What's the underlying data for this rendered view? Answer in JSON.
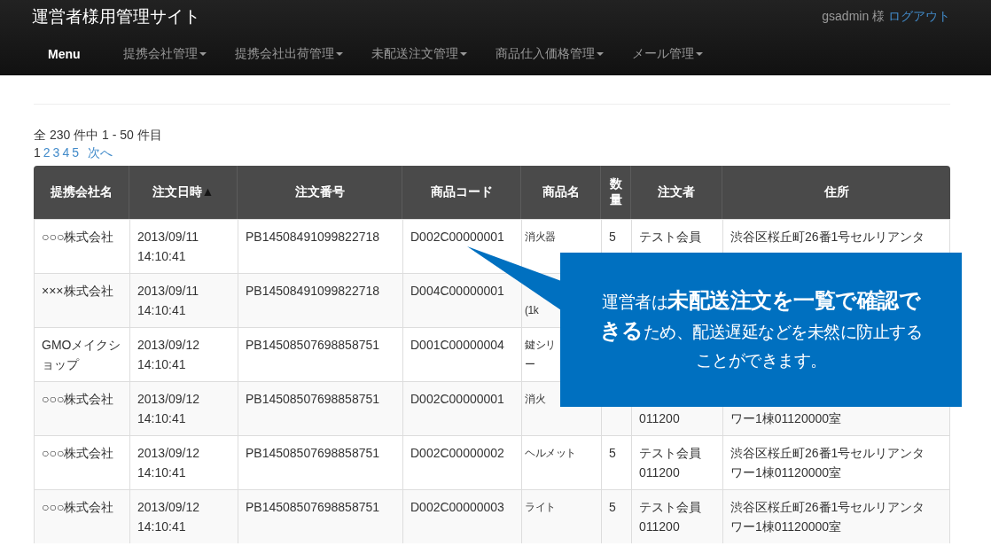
{
  "site_title": "運営者様用管理サイト",
  "user": {
    "name": "gsadmin 様",
    "logout": "ログアウト"
  },
  "nav": [
    {
      "label": "Menu",
      "kind": "brand"
    },
    {
      "label": "提携会社管理",
      "kind": "dropdown"
    },
    {
      "label": "提携会社出荷管理",
      "kind": "dropdown"
    },
    {
      "label": "未配送注文管理",
      "kind": "dropdown"
    },
    {
      "label": "商品仕入価格管理",
      "kind": "dropdown"
    },
    {
      "label": "メール管理",
      "kind": "dropdown"
    }
  ],
  "summary": "全 230 件中 1 - 50 件目",
  "pagination": {
    "pages": [
      {
        "label": "1",
        "selected": true
      },
      {
        "label": "2",
        "selected": false
      },
      {
        "label": "3",
        "selected": false
      },
      {
        "label": "4",
        "selected": false
      },
      {
        "label": "5",
        "selected": false
      }
    ],
    "next": "次へ"
  },
  "table": {
    "columns": [
      {
        "label": "提携会社名"
      },
      {
        "label": "注文日時",
        "sort_mark": "▲"
      },
      {
        "label": "注文番号"
      },
      {
        "label": "商品コード"
      },
      {
        "label": "商品名"
      },
      {
        "label": "数量"
      },
      {
        "label": "注文者"
      },
      {
        "label": "住所"
      }
    ],
    "rows": [
      [
        [
          "○○○株式会社"
        ],
        [
          "2013/09/11",
          "14:10:41"
        ],
        [
          "PB14508491099822718"
        ],
        [
          "D002C00000001"
        ],
        [
          "消火器"
        ],
        [
          "5"
        ],
        [
          "テスト会員",
          null
        ],
        [
          "渋谷区桜丘町26番1号セルリアンタ",
          null
        ]
      ],
      [
        [
          "×××株式会社"
        ],
        [
          "2013/09/11",
          "14:10:41"
        ],
        [
          "PB14508491099822718"
        ],
        [
          "D004C00000001"
        ],
        [
          null,
          "(1k"
        ],
        [],
        [],
        []
      ],
      [
        [
          "GMOメイクシ",
          "ョップ"
        ],
        [
          "2013/09/12",
          "14:10:41"
        ],
        [
          "PB14508507698858751"
        ],
        [
          "D001C00000004"
        ],
        [
          "鍵シリ",
          "ー"
        ],
        [],
        [],
        []
      ],
      [
        [
          "○○○株式会社"
        ],
        [
          "2013/09/12",
          "14:10:41"
        ],
        [
          "PB14508507698858751"
        ],
        [
          "D002C00000001"
        ],
        [
          "消火"
        ],
        [],
        [
          null,
          "011200"
        ],
        [
          null,
          "ワー1棟01120000室"
        ]
      ],
      [
        [
          "○○○株式会社"
        ],
        [
          "2013/09/12",
          "14:10:41"
        ],
        [
          "PB14508507698858751"
        ],
        [
          "D002C00000002"
        ],
        [
          "ヘルメット"
        ],
        [
          "5"
        ],
        [
          "テスト会員",
          "011200"
        ],
        [
          "渋谷区桜丘町26番1号セルリアンタ",
          "ワー1棟01120000室"
        ]
      ],
      [
        [
          "○○○株式会社"
        ],
        [
          "2013/09/12",
          "14:10:41"
        ],
        [
          "PB14508507698858751"
        ],
        [
          "D002C00000003"
        ],
        [
          "ライト"
        ],
        [
          "5"
        ],
        [
          "テスト会員",
          "011200"
        ],
        [
          "渋谷区桜丘町26番1号セルリアンタ",
          "ワー1棟01120000室"
        ]
      ]
    ]
  },
  "callout": {
    "text": "運営者は**未配送注文を一覧で確認できる**ため、配送遅延などを未然に防止することができます。"
  }
}
